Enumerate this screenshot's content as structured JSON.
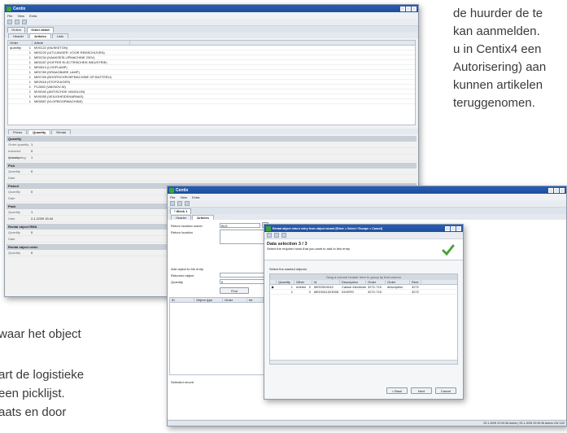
{
  "background_text": {
    "right_lines": [
      "de huurder de te",
      "kan aanmelden.",
      "u in Centix4 een",
      "Autorisering) aan",
      "kunnen artikelen",
      "teruggenomen."
    ],
    "left_lines": [
      "waar het object",
      "art de logistieke",
      "een picklijst.",
      "aats en door"
    ]
  },
  "win1": {
    "title": "Centix",
    "menu": [
      "File",
      "View",
      "Extra"
    ],
    "doc_tabs": [
      "Orders",
      "Order detail"
    ],
    "tabs": [
      "Header",
      "Articles",
      "Lists"
    ],
    "grid_headers": [
      "Order quantity",
      "Article"
    ],
    "rows": [
      {
        "qty": "1",
        "article": "MV0122 (MUSKETON)"
      },
      {
        "qty": "1",
        "article": "ME0220 (UITLUINGER: VOOR REMSCHIJVEN)"
      },
      {
        "qty": "1",
        "article": "ME0234 (HAAKSESLIJPMACHINE 230V)"
      },
      {
        "qty": "1",
        "article": "ME0287 (KOFFER ELECTRISCHEN INDUSTRIE)"
      },
      {
        "qty": "1",
        "article": "ME0813 (LOOPLAMP)"
      },
      {
        "qty": "1",
        "article": "ME0789 (DRAAGBARE LAMP)"
      },
      {
        "qty": "1",
        "article": "ME0783 (BOORSCHROEFMACHINE OP BATTERIJ)"
      },
      {
        "qty": "1",
        "article": "ME2818 (STOFZUIGER)"
      },
      {
        "qty": "1",
        "article": "PL2650 (VAKNOV-W)"
      },
      {
        "qty": "1",
        "article": "MV0040 (ANTISCHOK VANGLIJN)"
      },
      {
        "qty": "1",
        "article": "MV0055 (VEILIGHEIDSHARNAS)"
      },
      {
        "qty": "1",
        "article": "ME0887 (KLOPBOORMACHINE)"
      }
    ],
    "detail_tabs": [
      "Prices",
      "Quantity",
      "Rental"
    ],
    "sections": [
      {
        "title": "Quantity",
        "fields": [
          [
            "Order quantity",
            "1"
          ],
          [
            "Instaned quantity",
            "0"
          ],
          [
            "Outstanding",
            "1"
          ]
        ]
      },
      {
        "title": "Pick",
        "fields": [
          [
            "Quantity",
            "0"
          ],
          [
            "Date",
            ""
          ]
        ]
      },
      {
        "title": "Picked",
        "fields": [
          [
            "Quantity",
            "0"
          ],
          [
            "Date",
            ""
          ]
        ]
      },
      {
        "title": "Pack",
        "fields": [
          [
            "Quantity",
            "1"
          ],
          [
            "Date",
            "2-1-2009 15:44"
          ]
        ]
      },
      {
        "title": "Rental object RMA",
        "fields": [
          [
            "Quantity",
            "0"
          ],
          [
            "Date",
            ""
          ]
        ]
      },
      {
        "title": "Rental object order",
        "fields": [
          [
            "Quantity",
            "0"
          ]
        ]
      }
    ]
  },
  "win2": {
    "title": "Centix",
    "menu": [
      "File",
      "View",
      "Extra"
    ],
    "doc_tab": "* Week 1",
    "tabs": [
      "Header",
      "Articles"
    ],
    "labels": {
      "return_location_owner": "Return location owner",
      "return_location": "Return location",
      "owner_value": "BLS",
      "owner_name": "LO - Logistics",
      "add_object": "Add object to the entry",
      "returned_object": "Returned object",
      "quantity": "Quantity",
      "quantity_value": "0",
      "find": "Find",
      "selected_record": "Selected record"
    },
    "grid_headers": [
      "ID",
      "Object type",
      "Order",
      "Ite"
    ],
    "status": "29-1-2009 22:09:36  Admin  |  29-1-2009 22:09:36  Admin  CW  11/0"
  },
  "dialog": {
    "title": "Rental object return entry from object wizard [Enter = Select / Escape = Cancel]",
    "heading": "Data selection 3 / 3",
    "subheading": "Select the required rows that you want to add to this entry",
    "select_label": "Select the wanted objects:",
    "drag_hint": "Drag a column header here to group by that column",
    "columns": [
      "Quantity",
      "Other entries",
      "Id",
      "Description",
      "Order",
      "Order description",
      "Rent"
    ],
    "rows": [
      [
        "1",
        "0",
        "ME03510042",
        "Caisse électricien",
        "3272-715",
        "",
        "3272"
      ],
      [
        "1",
        "0",
        "ME03511023006",
        "DIVERS",
        "3272-715",
        "",
        "3272"
      ]
    ],
    "buttons": {
      "back": "< Back",
      "next": "Next",
      "cancel": "Cancel"
    },
    "colors": {
      "check": "#4aa33a"
    }
  }
}
